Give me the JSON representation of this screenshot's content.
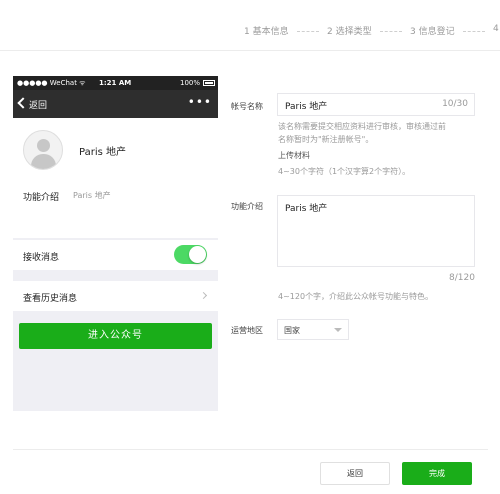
{
  "steps": [
    {
      "label": "1 基本信息"
    },
    {
      "label": "2 选择类型"
    },
    {
      "label": "3 信息登记"
    },
    {
      "label": "4"
    }
  ],
  "phone": {
    "status": {
      "carrier": "●●●●● WeChat ᯤ",
      "time": "1:21 AM",
      "battery": "100%"
    },
    "nav": {
      "back_label": "返回",
      "more": "•••"
    },
    "profile": {
      "name": "Paris 地产"
    },
    "intro": {
      "label": "功能介绍",
      "value": "Paris 地产"
    },
    "receive": {
      "label": "接收消息",
      "on": true
    },
    "history": {
      "label": "查看历史消息"
    },
    "enter_button": "进入公众号"
  },
  "form": {
    "name": {
      "label": "帐号名称",
      "value": "Paris 地产",
      "counter": "10/30",
      "hint_line1": "该名称需要提交相应资料进行审核，审核通过前",
      "hint_line2": "名称暂时为\"新注册帐号\"。",
      "upload": "上传材料",
      "rule": "4~30个字符（1个汉字算2个字符）。"
    },
    "intro": {
      "label": "功能介绍",
      "value": "Paris 地产",
      "counter": "8/120",
      "rule": "4~120个字，介绍此公众帐号功能与特色。"
    },
    "region": {
      "label": "运营地区",
      "value": "国家"
    }
  },
  "footer": {
    "back": "返回",
    "done": "完成"
  },
  "colors": {
    "accent": "#1aad19",
    "toggle_on": "#4cd964"
  }
}
